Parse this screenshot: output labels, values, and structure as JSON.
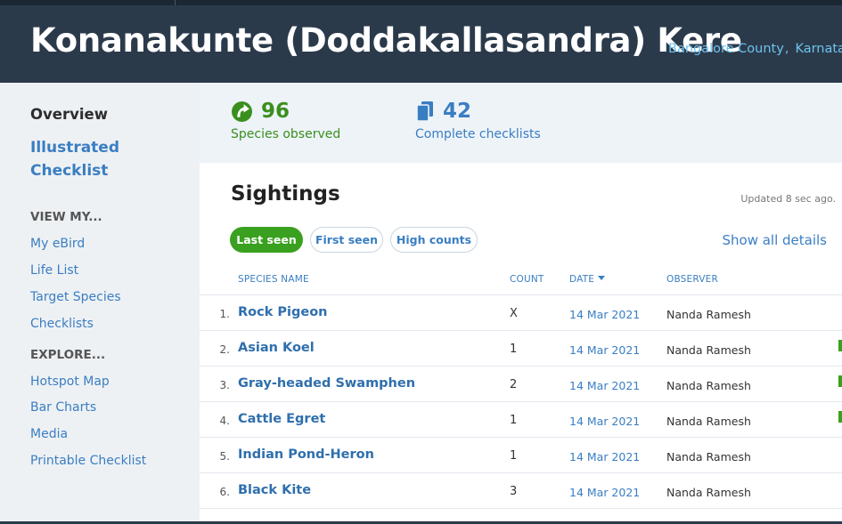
{
  "header": {
    "title": "Konanakunte (Doddakallasandra) Kere",
    "county": "Bangalore County",
    "state": "Karnataka"
  },
  "sidebar": {
    "overview": "Overview",
    "illustrated": "Illustrated Checklist",
    "view_heading": "VIEW MY...",
    "view_links": [
      "My eBird",
      "Life List",
      "Target Species",
      "Checklists"
    ],
    "explore_heading": "EXPLORE...",
    "explore_links": [
      "Hotspot Map",
      "Bar Charts",
      "Media",
      "Printable Checklist"
    ]
  },
  "stats": {
    "species_count": "96",
    "species_label": "Species observed",
    "checklists_count": "42",
    "checklists_label": "Complete checklists"
  },
  "sightings": {
    "title": "Sightings",
    "updated": "Updated 8 sec ago.",
    "tabs": [
      "Last seen",
      "First seen",
      "High counts"
    ],
    "active_tab": "Last seen",
    "show_all": "Show all details",
    "columns": {
      "species": "SPECIES NAME",
      "count": "COUNT",
      "date": "DATE",
      "observer": "OBSERVER"
    },
    "rows": [
      {
        "index": "1.",
        "species": "Rock Pigeon",
        "count": "X",
        "date": "14 Mar 2021",
        "observer": "Nanda Ramesh",
        "marked": false
      },
      {
        "index": "2.",
        "species": "Asian Koel",
        "count": "1",
        "date": "14 Mar 2021",
        "observer": "Nanda Ramesh",
        "marked": true
      },
      {
        "index": "3.",
        "species": "Gray-headed Swamphen",
        "count": "2",
        "date": "14 Mar 2021",
        "observer": "Nanda Ramesh",
        "marked": true
      },
      {
        "index": "4.",
        "species": "Cattle Egret",
        "count": "1",
        "date": "14 Mar 2021",
        "observer": "Nanda Ramesh",
        "marked": true
      },
      {
        "index": "5.",
        "species": "Indian Pond-Heron",
        "count": "1",
        "date": "14 Mar 2021",
        "observer": "Nanda Ramesh",
        "marked": false
      },
      {
        "index": "6.",
        "species": "Black Kite",
        "count": "3",
        "date": "14 Mar 2021",
        "observer": "Nanda Ramesh",
        "marked": false
      }
    ]
  },
  "colors": {
    "header_bg": "#2b3a4b",
    "link_blue": "#3a7ec2",
    "green": "#3aa01f"
  }
}
